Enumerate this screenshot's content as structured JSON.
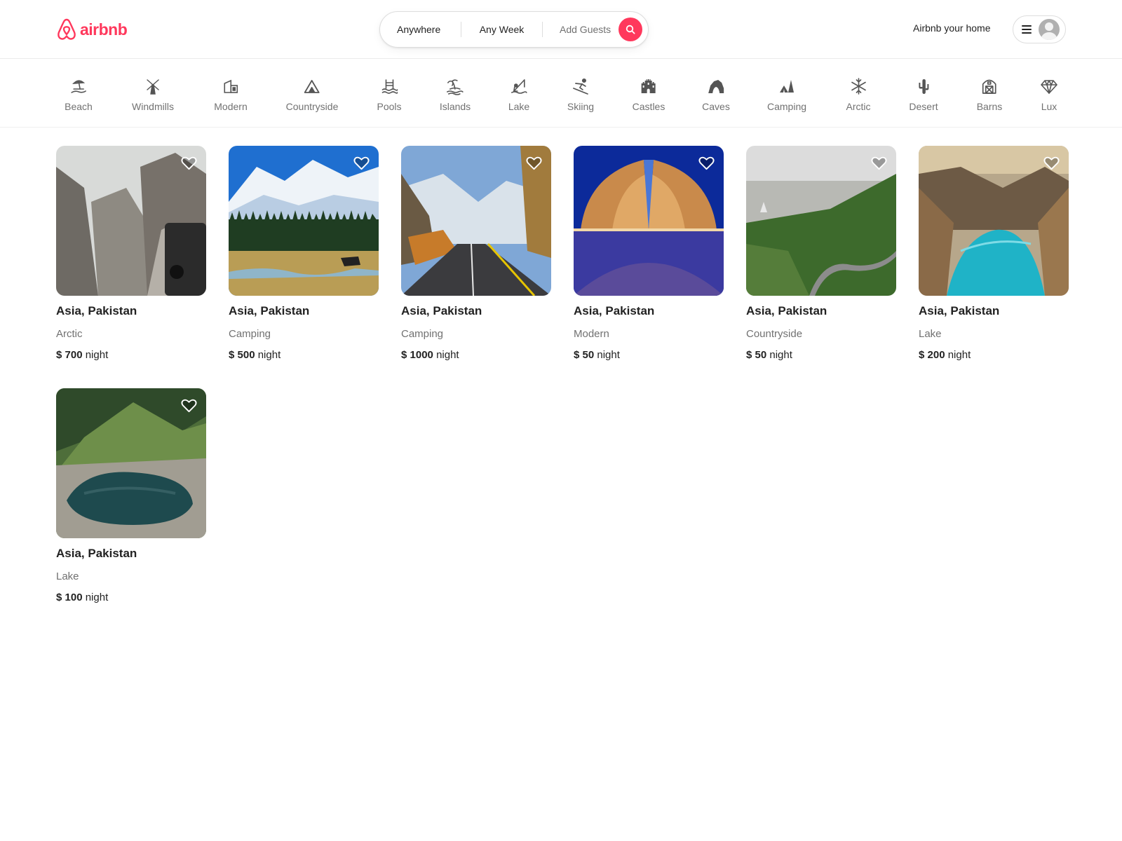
{
  "header": {
    "logo_text": "airbnb",
    "brand_color": "#ff385c",
    "search": {
      "anywhere": "Anywhere",
      "any_week": "Any Week",
      "add_guests": "Add Guests"
    },
    "host_link": "Airbnb your home"
  },
  "categories": [
    {
      "label": "Beach",
      "icon": "beach-icon"
    },
    {
      "label": "Windmills",
      "icon": "windmill-icon"
    },
    {
      "label": "Modern",
      "icon": "modern-house-icon"
    },
    {
      "label": "Countryside",
      "icon": "mountain-icon"
    },
    {
      "label": "Pools",
      "icon": "pool-icon"
    },
    {
      "label": "Islands",
      "icon": "island-icon"
    },
    {
      "label": "Lake",
      "icon": "lake-fishing-icon"
    },
    {
      "label": "Skiing",
      "icon": "skiing-icon"
    },
    {
      "label": "Castles",
      "icon": "castle-icon"
    },
    {
      "label": "Caves",
      "icon": "cave-icon"
    },
    {
      "label": "Camping",
      "icon": "camping-tent-icon"
    },
    {
      "label": "Arctic",
      "icon": "snowflake-icon"
    },
    {
      "label": "Desert",
      "icon": "cactus-icon"
    },
    {
      "label": "Barns",
      "icon": "barn-icon"
    },
    {
      "label": "Lux",
      "icon": "diamond-icon"
    }
  ],
  "listings": [
    {
      "title": "Asia, Pakistan",
      "category": "Arctic",
      "currency": "$",
      "price": "700",
      "unit": "night",
      "photo": "mountain-road-jeep"
    },
    {
      "title": "Asia, Pakistan",
      "category": "Camping",
      "currency": "$",
      "price": "500",
      "unit": "night",
      "photo": "snow-peak-meadow-horse"
    },
    {
      "title": "Asia, Pakistan",
      "category": "Camping",
      "currency": "$",
      "price": "1000",
      "unit": "night",
      "photo": "autumn-valley-road"
    },
    {
      "title": "Asia, Pakistan",
      "category": "Modern",
      "currency": "$",
      "price": "50",
      "unit": "night",
      "photo": "monument-night"
    },
    {
      "title": "Asia, Pakistan",
      "category": "Countryside",
      "currency": "$",
      "price": "50",
      "unit": "night",
      "photo": "green-hills-city"
    },
    {
      "title": "Asia, Pakistan",
      "category": "Lake",
      "currency": "$",
      "price": "200",
      "unit": "night",
      "photo": "turquoise-lake-canyon"
    },
    {
      "title": "Asia, Pakistan",
      "category": "Lake",
      "currency": "$",
      "price": "100",
      "unit": "night",
      "photo": "mountain-lake"
    }
  ]
}
